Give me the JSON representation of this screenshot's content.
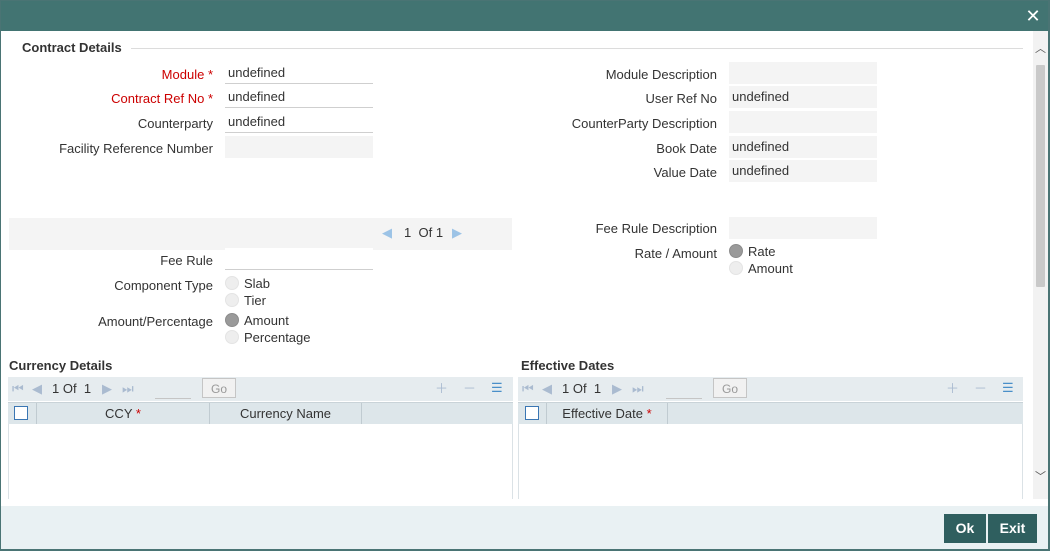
{
  "window": {
    "close_icon": "close-icon"
  },
  "contract_details": {
    "title": "Contract Details",
    "module_label": "Module",
    "module_value": "undefined",
    "contract_ref_label": "Contract Ref No",
    "contract_ref_value": "undefined",
    "counterparty_label": "Counterparty",
    "counterparty_value": "undefined",
    "facility_ref_label": "Facility Reference Number",
    "facility_ref_value": "",
    "module_desc_label": "Module Description",
    "module_desc_value": "",
    "user_ref_label": "User Ref No",
    "user_ref_value": "undefined",
    "counterparty_desc_label": "CounterParty Description",
    "counterparty_desc_value": "",
    "book_date_label": "Book Date",
    "book_date_value": "undefined",
    "value_date_label": "Value Date",
    "value_date_value": "undefined",
    "required_marker": "*"
  },
  "fee": {
    "pager_current": "1",
    "pager_of": "Of",
    "pager_total": "1",
    "fee_rule_label": "Fee Rule",
    "fee_rule_value": "",
    "component_type_label": "Component Type",
    "component_options": [
      "Slab",
      "Tier"
    ],
    "amount_pct_label": "Amount/Percentage",
    "amount_pct_options": [
      "Amount",
      "Percentage"
    ],
    "fee_rule_desc_label": "Fee Rule Description",
    "fee_rule_desc_value": "",
    "rate_amount_label": "Rate / Amount",
    "rate_amount_options": [
      "Rate",
      "Amount"
    ]
  },
  "currency_details": {
    "title": "Currency Details",
    "page_current": "1",
    "page_of": "Of",
    "page_total": "1",
    "go_label": "Go",
    "columns": [
      "CCY",
      "Currency Name"
    ]
  },
  "effective_dates": {
    "title": "Effective Dates",
    "page_current": "1",
    "page_of": "Of",
    "page_total": "1",
    "go_label": "Go",
    "columns": [
      "Effective Date"
    ]
  },
  "footer": {
    "ok_label": "Ok",
    "exit_label": "Exit"
  }
}
